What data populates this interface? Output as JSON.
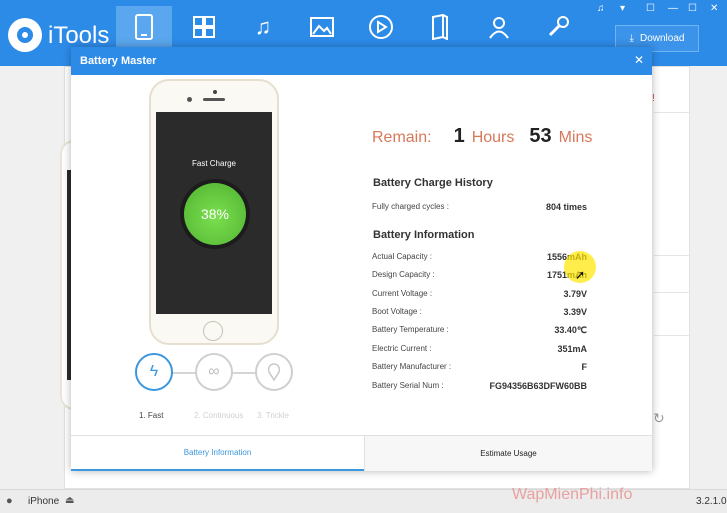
{
  "app": {
    "name": "iTools",
    "download_label": "Download",
    "version": "3.2.1.0"
  },
  "nav_icons": [
    "device-icon",
    "apps-icon",
    "music-icon",
    "photos-icon",
    "video-icon",
    "books-icon",
    "contacts-icon",
    "tools-icon"
  ],
  "device": {
    "name": "iPhone"
  },
  "watermark": "WapMienPhi.info",
  "background": {
    "alert": "!"
  },
  "modal": {
    "title": "Battery Master",
    "close": "✕",
    "phone": {
      "fast_charge_label": "Fast Charge",
      "percent": "38%"
    },
    "modes": [
      "1. Fast",
      "2. Continuous",
      "3. Trickle"
    ],
    "remain": {
      "label": "Remain:",
      "hours": "1",
      "hours_unit": "Hours",
      "mins": "53",
      "mins_unit": "Mins"
    },
    "history": {
      "title": "Battery Charge History",
      "rows": [
        {
          "label": "Fully charged cycles :",
          "value": "804 times"
        }
      ]
    },
    "info": {
      "title": "Battery Information",
      "rows": [
        {
          "label": "Actual Capacity :",
          "value": "1556mAh"
        },
        {
          "label": "Design Capacity :",
          "value": "1751mAh"
        },
        {
          "label": "Current Voltage :",
          "value": "3.79V"
        },
        {
          "label": "Boot Voltage :",
          "value": "3.39V"
        },
        {
          "label": "Battery Temperature :",
          "value": "33.40℃"
        },
        {
          "label": "Electric Current :",
          "value": "351mA"
        },
        {
          "label": "Battery Manufacturer :",
          "value": "F"
        },
        {
          "label": "Battery Serial Num :",
          "value": "FG94356B63DFW60BB"
        }
      ]
    },
    "tabs": [
      "Battery Information",
      "Estimate Usage"
    ]
  },
  "colors": {
    "header": "#2d8be8",
    "accent": "#3b98de",
    "remain": "#d8785a",
    "charge": "#6fd14a"
  }
}
